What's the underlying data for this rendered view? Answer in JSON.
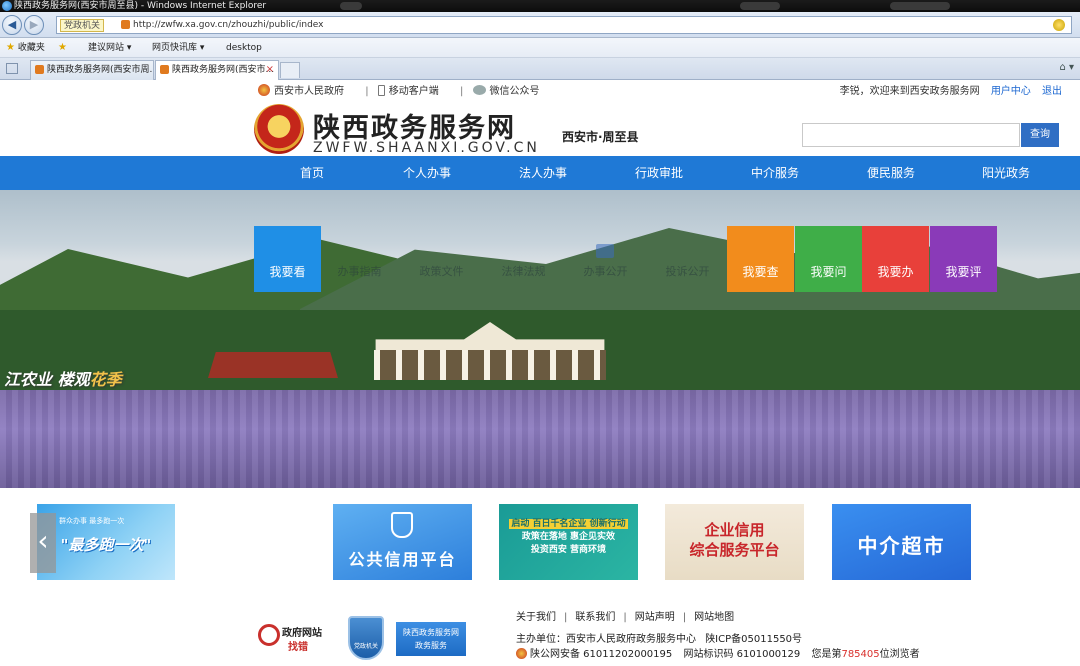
{
  "browser": {
    "window_title": "陕西政务服务网(西安市周至县) - Windows Internet Explorer",
    "compat_label": "党政机关",
    "url": "http://zwfw.xa.gov.cn/zhouzhi/public/index",
    "favorites": {
      "label": "收藏夹",
      "items": [
        "建议网站 ▾",
        "网页快讯库 ▾",
        "desktop"
      ]
    },
    "tabs": [
      {
        "label": "陕西政务服务网(西安市周..."
      },
      {
        "label": "陕西政务服务网(西安市..."
      }
    ]
  },
  "topline": {
    "gov_link": "西安市人民政府",
    "mobile_link": "移动客户端",
    "wechat_link": "微信公众号",
    "welcome": "李锐，欢迎来到西安政务服务网",
    "user_center": "用户中心",
    "logout": "退出"
  },
  "header": {
    "site_title": "陕西政务服务网",
    "site_domain": "ZWFW.SHAANXI.GOV.CN",
    "region": "西安市·周至县",
    "search_button": "查询"
  },
  "nav": {
    "items": [
      "首页",
      "个人办事",
      "法人办事",
      "行政审批",
      "中介服务",
      "便民服务",
      "阳光政务"
    ]
  },
  "banner": {
    "slogan_part1": "江农业",
    "slogan_part2": "楼观",
    "slogan_part3": "花季",
    "tiles": [
      {
        "label": "我要看",
        "color": "#1f8fe6"
      },
      {
        "label": "我要查",
        "color": "#f28c1c"
      },
      {
        "label": "我要问",
        "color": "#3fae48"
      },
      {
        "label": "我要办",
        "color": "#e8403a"
      },
      {
        "label": "我要评",
        "color": "#8a3ab8"
      }
    ],
    "ghost_items": [
      "办事指南",
      "政策文件",
      "法律法规",
      "办事公开",
      "投诉公开"
    ]
  },
  "carousel": {
    "cards": [
      {
        "label": "\"最多跑一次\"",
        "sub": "群众办事 最多跑一次"
      },
      {
        "label": "公共信用平台"
      },
      {
        "line1": "启动 百日千名企业 创新行动",
        "line2": "政策在落地 惠企见实效",
        "line3": "投资西安 营商环境"
      },
      {
        "line1": "企业信用",
        "line2": "综合服务平台"
      },
      {
        "label": "中介超市"
      }
    ]
  },
  "footer": {
    "jiucuo_title": "政府网站",
    "jiucuo_sub": "找错",
    "shield_label": "党政机关",
    "badge_line1": "陕西政务服务网",
    "badge_line2": "政务服务",
    "links": [
      "关于我们",
      "联系我们",
      "网站声明",
      "网站地图"
    ],
    "host": "主办单位：西安市人民政府政务服务中心",
    "icp": "陕ICP备05011550号",
    "police_record": "陕公网安备 61011202000195",
    "site_code": "网站标识码 6101000129",
    "visitor_prefix": "您是第",
    "visitor_count": "785405",
    "visitor_suffix": "位浏览者"
  }
}
